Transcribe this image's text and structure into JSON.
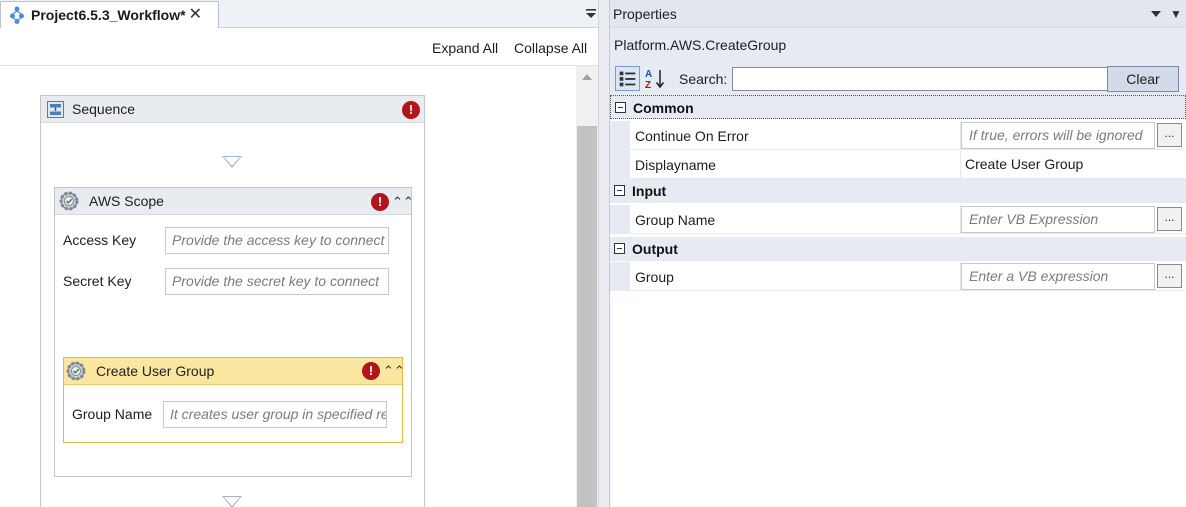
{
  "document_tab": {
    "title": "Project6.5.3_Workflow*",
    "close_glyph": "✕"
  },
  "designer_toolbar": {
    "expand_all": "Expand All",
    "collapse_all": "Collapse All"
  },
  "sequence": {
    "title": "Sequence",
    "error_glyph": "!",
    "aws_scope": {
      "title": "AWS Scope",
      "fields": [
        {
          "label": "Access Key",
          "placeholder": "Provide the access key to connect"
        },
        {
          "label": "Secret Key",
          "placeholder": "Provide the secret key to connect"
        }
      ],
      "create_user_group": {
        "title": "Create User Group",
        "field": {
          "label": "Group Name",
          "placeholder": "It creates user group in specified region"
        }
      }
    }
  },
  "properties": {
    "panel_title": "Properties",
    "activity_type": "Platform.AWS.CreateGroup",
    "search_label": "Search:",
    "search_value": "",
    "clear_label": "Clear",
    "ellipsis": "...",
    "categories": [
      {
        "name": "Common",
        "rows": [
          {
            "name": "Continue On Error",
            "placeholder": "If true, errors will be ignored"
          },
          {
            "name": "Displayname",
            "value": "Create User Group"
          }
        ]
      },
      {
        "name": "Input",
        "rows": [
          {
            "name": "Group Name",
            "placeholder": "Enter VB Expression"
          }
        ]
      },
      {
        "name": "Output",
        "rows": [
          {
            "name": "Group",
            "placeholder": "Enter a VB expression"
          }
        ]
      }
    ]
  },
  "colors": {
    "error_red": "#b1141b",
    "selected_header": "#fbe6a0",
    "selected_border": "#e4b94a",
    "panel_bg": "#e6ebf3"
  },
  "icons": [
    "workflow-icon",
    "close-icon",
    "menu-dropdown-icon",
    "sequence-icon",
    "error-icon",
    "gear-activity-icon",
    "collapse-chevron-icon",
    "categorized-icon",
    "alphabetical-sort-icon",
    "pin-icon"
  ]
}
